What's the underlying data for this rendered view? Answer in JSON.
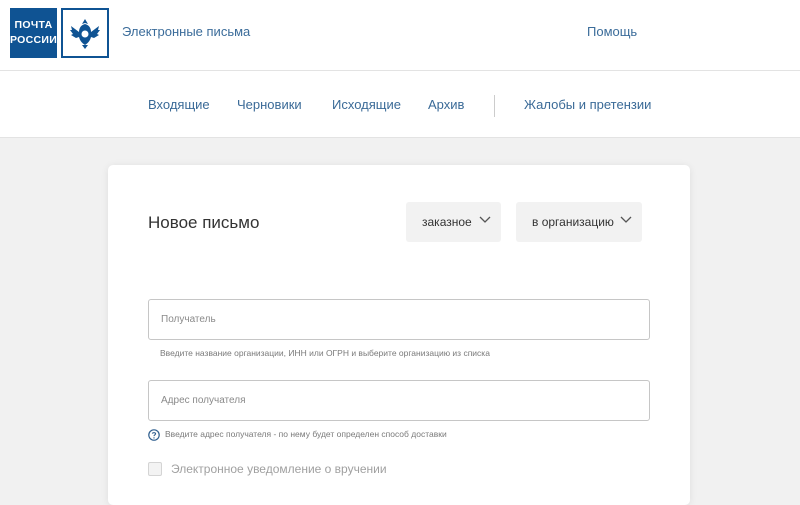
{
  "header": {
    "logo_line1": "ПОЧТА",
    "logo_line2": "РОССИИ",
    "service_title": "Электронные письма",
    "help_label": "Помощь"
  },
  "nav": {
    "items": [
      {
        "label": "Входящие"
      },
      {
        "label": "Черновики"
      },
      {
        "label": "Исходящие"
      },
      {
        "label": "Архив"
      },
      {
        "label": "Жалобы и претензии"
      }
    ]
  },
  "form": {
    "title": "Новое письмо",
    "letter_type": {
      "selected": "заказное",
      "icon": "chevron-down-icon"
    },
    "destination": {
      "selected": "в организацию",
      "icon": "chevron-down-icon"
    },
    "recipient": {
      "placeholder": "Получатель",
      "value": "",
      "hint": "Введите название организации, ИНН или ОГРН и выберите организацию из списка"
    },
    "address": {
      "placeholder": "Адрес получателя",
      "value": "",
      "hint": "Введите адрес получателя - по нему будет определен способ доставки",
      "hint_icon": "question-circle-icon"
    },
    "notification": {
      "label": "Электронное уведомление о вручении",
      "checked": false
    }
  },
  "colors": {
    "brand_blue": "#0f5393",
    "link_blue": "#3a6a97",
    "background": "#f1f1f1"
  }
}
